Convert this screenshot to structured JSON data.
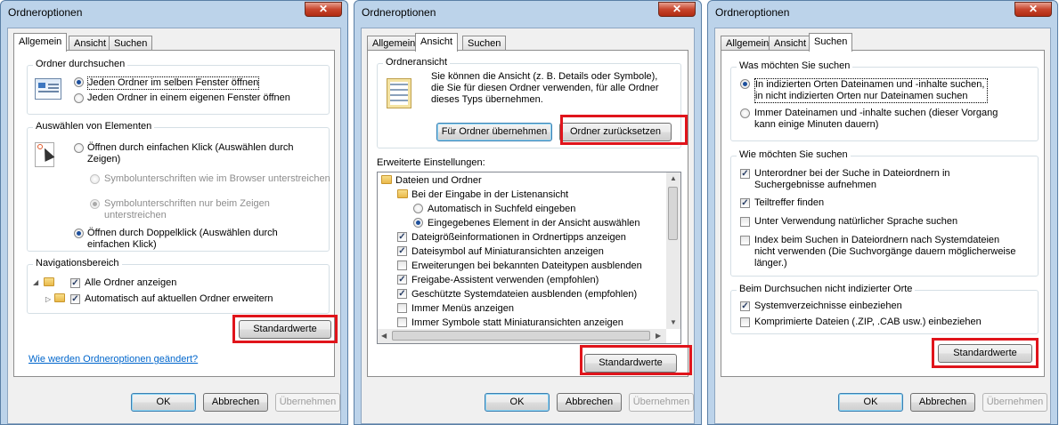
{
  "dialogs": [
    {
      "title": "Ordneroptionen",
      "tabs": [
        "Allgemein",
        "Ansicht",
        "Suchen"
      ],
      "active_tab": "Allgemein",
      "groups": {
        "browse": {
          "title": "Ordner durchsuchen",
          "opt1": "Jeden Ordner im selben Fenster öffnen",
          "opt2": "Jeden Ordner in einem eigenen Fenster öffnen"
        },
        "click": {
          "title": "Auswählen von Elementen",
          "opt1": "Öffnen durch einfachen Klick (Auswählen durch Zeigen)",
          "sub1": "Symbolunterschriften wie im Browser unterstreichen",
          "sub2": "Symbolunterschriften nur beim Zeigen unterstreichen",
          "opt2": "Öffnen durch Doppelklick (Auswählen durch einfachen Klick)"
        },
        "nav": {
          "title": "Navigationsbereich",
          "cb1": "Alle Ordner anzeigen",
          "cb2": "Automatisch auf aktuellen Ordner erweitern"
        }
      },
      "defaults_button": "Standardwerte",
      "help_link": "Wie werden Ordneroptionen geändert?",
      "buttons": {
        "ok": "OK",
        "cancel": "Abbrechen",
        "apply": "Übernehmen"
      }
    },
    {
      "title": "Ordneroptionen",
      "tabs": [
        "Allgemein",
        "Ansicht",
        "Suchen"
      ],
      "active_tab": "Ansicht",
      "folder_view": {
        "title": "Ordneransicht",
        "text": "Sie können die Ansicht (z. B. Details oder Symbole), die Sie für diesen Ordner verwenden, für alle Ordner dieses Typs übernehmen.",
        "apply_btn": "Für Ordner übernehmen",
        "reset_btn": "Ordner zurücksetzen"
      },
      "advanced_label": "Erweiterte Einstellungen:",
      "tree": [
        "Dateien und Ordner",
        "Bei der Eingabe in der Listenansicht",
        "Automatisch in Suchfeld eingeben",
        "Eingegebenes Element in der Ansicht auswählen",
        "Dateigrößeinformationen in Ordnertipps anzeigen",
        "Dateisymbol auf Miniaturansichten anzeigen",
        "Erweiterungen bei bekannten Dateitypen ausblenden",
        "Freigabe-Assistent verwenden (empfohlen)",
        "Geschützte Systemdateien ausblenden (empfohlen)",
        "Immer Menüs anzeigen",
        "Immer Symbole statt Miniaturansichten anzeigen"
      ],
      "defaults_button": "Standardwerte",
      "buttons": {
        "ok": "OK",
        "cancel": "Abbrechen",
        "apply": "Übernehmen"
      }
    },
    {
      "title": "Ordneroptionen",
      "tabs": [
        "Allgemein",
        "Ansicht",
        "Suchen"
      ],
      "active_tab": "Suchen",
      "what": {
        "title": "Was möchten Sie suchen",
        "opt1": "In indizierten Orten Dateinamen und -inhalte suchen, in nicht indizierten Orten nur Dateinamen suchen",
        "opt2": "Immer Dateinamen und -inhalte suchen (dieser Vorgang kann einige Minuten dauern)"
      },
      "how": {
        "title": "Wie möchten Sie suchen",
        "cb1": "Unterordner bei der Suche in Dateiordnern in Suchergebnisse aufnehmen",
        "cb2": "Teiltreffer finden",
        "cb3": "Unter Verwendung natürlicher Sprache suchen",
        "cb4": "Index beim Suchen in Dateiordnern nach Systemdateien nicht verwenden (Die Suchvorgänge dauern möglicherweise länger.)"
      },
      "nonindexed": {
        "title": "Beim Durchsuchen nicht indizierter Orte",
        "cb1": "Systemverzeichnisse einbeziehen",
        "cb2": "Komprimierte Dateien (.ZIP, .CAB usw.) einbeziehen"
      },
      "defaults_button": "Standardwerte",
      "buttons": {
        "ok": "OK",
        "cancel": "Abbrechen",
        "apply": "Übernehmen"
      }
    }
  ],
  "close_glyph": "✕",
  "check_glyph": "✓",
  "highlight_color": "#e0141b"
}
